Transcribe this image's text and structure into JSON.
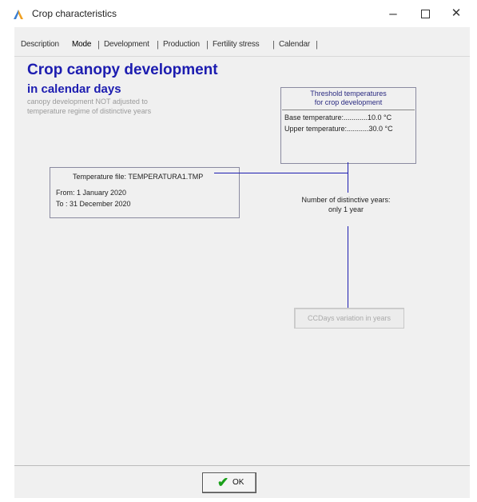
{
  "window": {
    "title": "Crop characteristics",
    "minimize": "–",
    "close": "✕"
  },
  "tabs": [
    {
      "label": "Description"
    },
    {
      "label": "Mode",
      "active": true
    },
    {
      "label": "Development"
    },
    {
      "label": "Production"
    },
    {
      "label": "Fertility stress"
    },
    {
      "label": "Calendar"
    }
  ],
  "main": {
    "heading": "Crop canopy development",
    "subheading": "in calendar days",
    "note": "canopy development NOT adjusted to temperature regime of distinctive years"
  },
  "threshold": {
    "title_line1": "Threshold temperatures",
    "title_line2": "for crop development",
    "base_label": "Base temperature:............10.0 °C",
    "upper_label": "Upper temperature:...........30.0 °C"
  },
  "temperature_file": {
    "title": "Temperature file: TEMPERATURA1.TMP",
    "from": "From: 1 January 2020",
    "to": "To  : 31 December 2020"
  },
  "years": {
    "line1": "Number of distinctive years:",
    "line2": "only 1 year"
  },
  "variation_button": {
    "label": "CCDays variation in years"
  },
  "footer": {
    "ok_label": "OK"
  },
  "colors": {
    "heading": "#1c1cb0",
    "connector": "#1c1cb0",
    "check": "#1aa01a"
  }
}
